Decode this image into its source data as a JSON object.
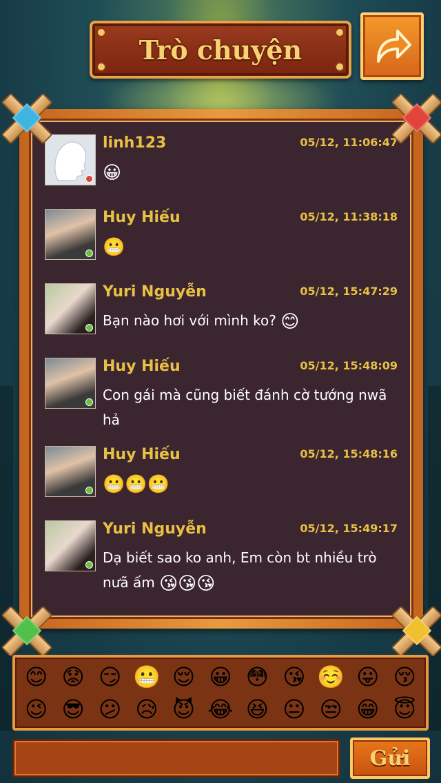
{
  "header": {
    "title": "Trò chuyện",
    "back_icon": "share-arrow-icon"
  },
  "messages": [
    {
      "name": "linh123",
      "time": "05/12, 11:06:47",
      "text": "",
      "emojis": [
        "😀"
      ],
      "status_color": "#d24a3a",
      "avatar": "placeholder-profile"
    },
    {
      "name": "Huy Hiếu",
      "time": "05/12, 11:38:18",
      "text": "",
      "emojis": [
        "😬"
      ],
      "status_color": "#6fc040",
      "avatar": "photo"
    },
    {
      "name": "Yuri Nguyễn",
      "time": "05/12, 15:47:29",
      "text": "Bạn nào hơi với mình ko?",
      "emojis": [
        "😊"
      ],
      "status_color": "#6fc040",
      "avatar": "photo"
    },
    {
      "name": "Huy Hiếu",
      "time": "05/12, 15:48:09",
      "text": "Con gái mà cũng biết đánh cờ tướng nwã hả",
      "emojis": [],
      "status_color": "#6fc040",
      "avatar": "photo"
    },
    {
      "name": "Huy Hiếu",
      "time": "05/12, 15:48:16",
      "text": "",
      "emojis": [
        "😬",
        "😬",
        "😬"
      ],
      "status_color": "#6fc040",
      "avatar": "photo"
    },
    {
      "name": "Yuri Nguyễn",
      "time": "05/12, 15:49:17",
      "text": "Dạ biết sao ko anh, Em còn bt nhiều trò nưã ấm",
      "emojis": [
        "😘",
        "😘",
        "😘"
      ],
      "status_color": "#6fc040",
      "avatar": "photo"
    }
  ],
  "emoji_picker": [
    "😊",
    "😟",
    "😏",
    "😬",
    "😌",
    "😀",
    "😳",
    "😘",
    "☺️",
    "😛",
    "😚",
    "😉",
    "😎",
    "😕",
    "😥",
    "😈",
    "😂",
    "😆",
    "😐",
    "😒",
    "😁",
    "😇"
  ],
  "input": {
    "value": "",
    "placeholder": ""
  },
  "send_label": "Gửi",
  "colors": {
    "accent_gold": "#e8c044",
    "panel": "#3b2630",
    "wood": "#e99a3e"
  }
}
